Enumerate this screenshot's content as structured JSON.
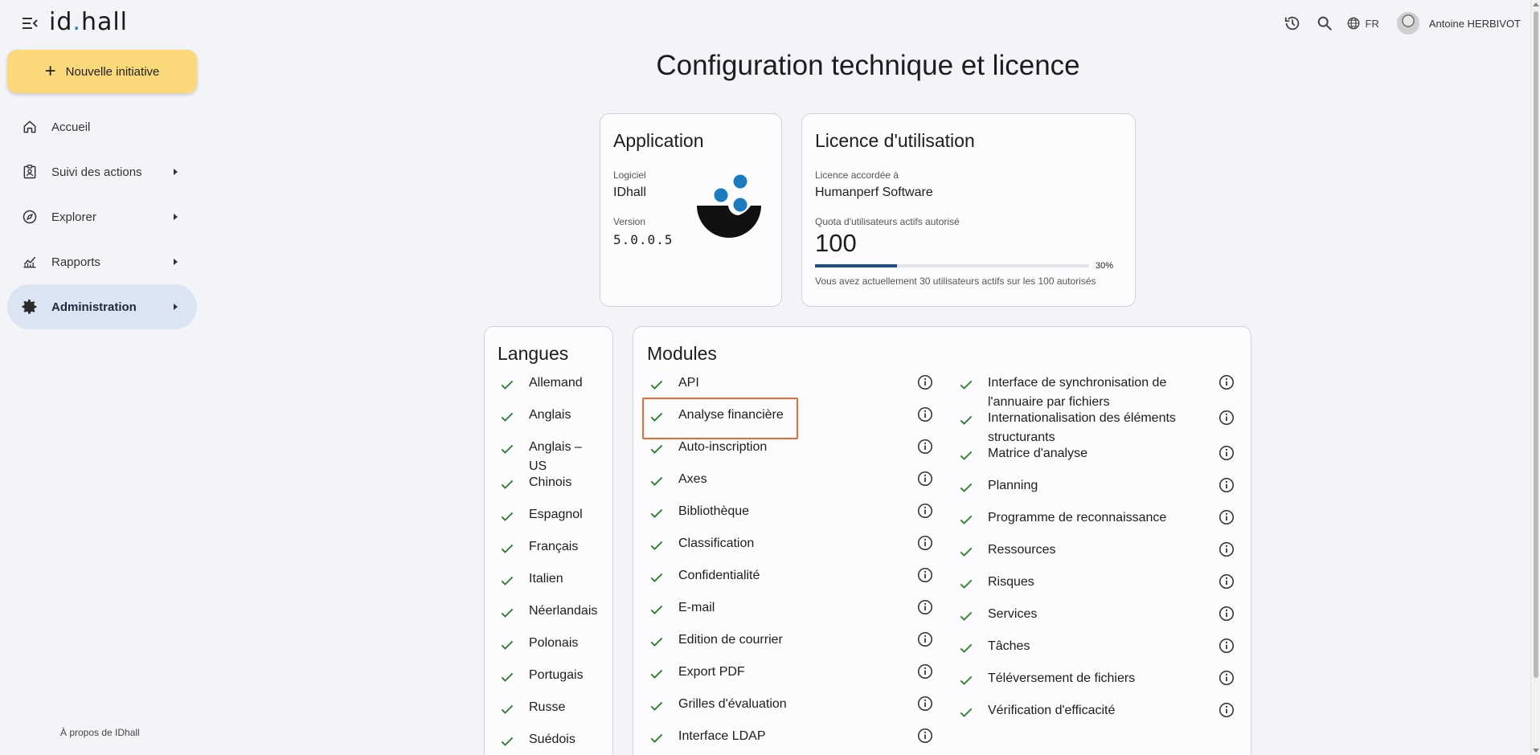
{
  "app": {
    "logo_text_1": "id",
    "logo_dot": ".",
    "logo_text_2": "hall"
  },
  "topbar": {
    "language": "FR",
    "user_name": "Antoine HERBIVOT"
  },
  "sidebar": {
    "new_button_label": "Nouvelle initiative",
    "items": [
      {
        "label": "Accueil",
        "icon": "home-icon",
        "has_submenu": false,
        "active": false
      },
      {
        "label": "Suivi des actions",
        "icon": "clipboard-user-icon",
        "has_submenu": true,
        "active": false
      },
      {
        "label": "Explorer",
        "icon": "compass-icon",
        "has_submenu": true,
        "active": false
      },
      {
        "label": "Rapports",
        "icon": "chart-icon",
        "has_submenu": true,
        "active": false
      },
      {
        "label": "Administration",
        "icon": "gear-icon",
        "has_submenu": true,
        "active": true
      }
    ],
    "about_label": "À propos de IDhall"
  },
  "main": {
    "title": "Configuration technique et licence",
    "application": {
      "heading": "Application",
      "software_label": "Logiciel",
      "software_value": "IDhall",
      "version_label": "Version",
      "version_value": "5.0.0.5"
    },
    "licence": {
      "heading": "Licence d'utilisation",
      "granted_label": "Licence accordée à",
      "granted_value": "Humanperf Software",
      "quota_label": "Quota d'utilisateurs actifs autorisé",
      "quota_value": "100",
      "usage_fraction": 0.3,
      "usage_percent_label": "30%",
      "usage_note": "Vous avez actuellement 30 utilisateurs actifs sur les 100 autorisés"
    },
    "languages": {
      "heading": "Langues",
      "items": [
        "Allemand",
        "Anglais",
        "Anglais – US",
        "Chinois",
        "Espagnol",
        "Français",
        "Italien",
        "Néerlandais",
        "Polonais",
        "Portugais",
        "Russe",
        "Suédois"
      ]
    },
    "modules": {
      "heading": "Modules",
      "left": [
        "API",
        "Analyse financière",
        "Auto-inscription",
        "Axes",
        "Bibliothèque",
        "Classification",
        "Confidentialité",
        "E-mail",
        "Edition de courrier",
        "Export PDF",
        "Grilles d'évaluation",
        "Interface LDAP"
      ],
      "right": [
        "Interface de synchronisation de l'annuaire par fichiers",
        "Internationalisation des éléments structurants",
        "Matrice d'analyse",
        "Planning",
        "Programme de reconnaissance",
        "Ressources",
        "Risques",
        "Services",
        "Tâches",
        "Téléversement de fichiers",
        "Vérification d'efficacité"
      ],
      "highlighted": "Analyse financière"
    }
  },
  "colors": {
    "accent_yellow": "#fbd97a",
    "active_nav": "#dbe4f3",
    "check_green": "#2e7d32",
    "progress_fill": "#1d4f8c",
    "highlight_orange": "#ec6a2f",
    "logo_blue": "#1a7bc0"
  }
}
